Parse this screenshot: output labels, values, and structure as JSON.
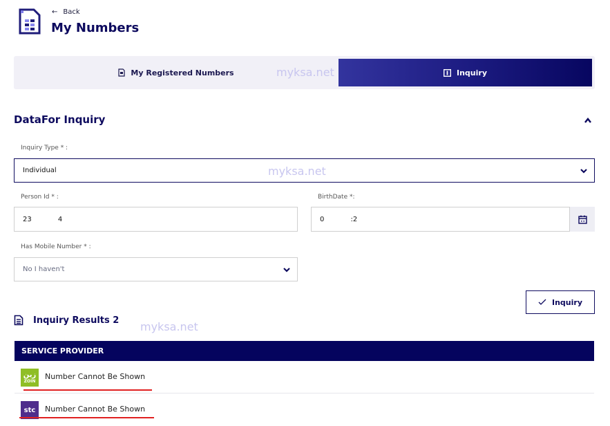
{
  "header": {
    "logo_icon": "sim-card-icon",
    "back_label": "Back",
    "title": "My Numbers"
  },
  "tabs": [
    {
      "label": "My Registered Numbers",
      "icon": "document-icon",
      "active": false
    },
    {
      "label": "Inquiry",
      "icon": "info-icon",
      "active": true
    }
  ],
  "watermark": "myksa.net",
  "form": {
    "section_title": "DataFor Inquiry",
    "inquiry_type": {
      "label": "Inquiry Type * :",
      "value": "Individual"
    },
    "person_id": {
      "label": "Person Id * :",
      "value": "23            4"
    },
    "birth_date": {
      "label": "BirthDate *:",
      "value": "0            :2"
    },
    "has_mobile": {
      "label": "Has Mobile Number * :",
      "value": "No I haven't"
    },
    "submit_label": "Inquiry"
  },
  "results": {
    "title": "Inquiry Results 2",
    "column_header": "SERVICE PROVIDER",
    "rows": [
      {
        "provider": "zain",
        "logo_text": "ZOIN",
        "text": "Number Cannot Be Shown"
      },
      {
        "provider": "stc",
        "logo_text": "stc",
        "text": "Number Cannot Be Shown"
      }
    ]
  },
  "colors": {
    "primary": "#0d0a5e",
    "zain": "#8fbe26",
    "stc": "#4f2d8c",
    "underline": "#e02020"
  }
}
